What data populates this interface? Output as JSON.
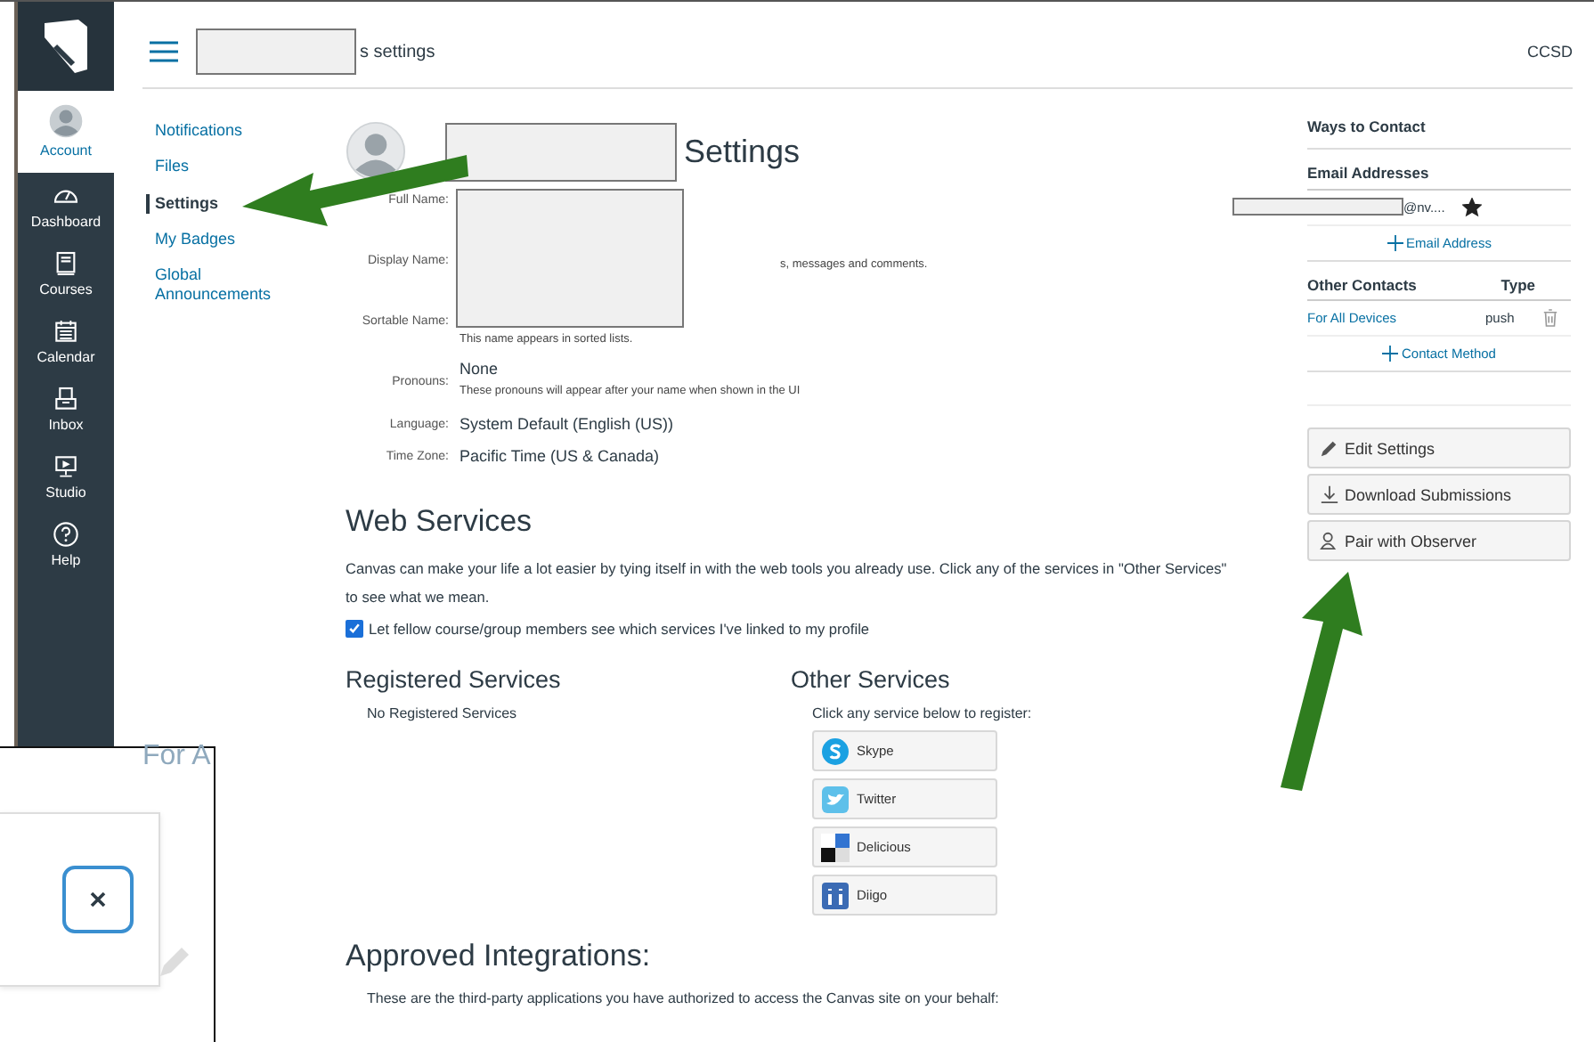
{
  "global_nav": {
    "items": [
      {
        "kind": "account",
        "label": "Account",
        "selected": true
      },
      {
        "kind": "dashboard",
        "label": "Dashboard",
        "selected": false
      },
      {
        "kind": "courses",
        "label": "Courses",
        "selected": false
      },
      {
        "kind": "calendar",
        "label": "Calendar",
        "selected": false
      },
      {
        "kind": "inbox",
        "label": "Inbox",
        "selected": false
      },
      {
        "kind": "studio",
        "label": "Studio",
        "selected": false
      },
      {
        "kind": "help",
        "label": "Help",
        "selected": false
      }
    ]
  },
  "header": {
    "title": "s settings",
    "org": "CCSD"
  },
  "sub_nav": [
    {
      "label": "Notifications",
      "selected": false
    },
    {
      "label": "Files",
      "selected": false
    },
    {
      "label": "Settings",
      "selected": true
    },
    {
      "label": "My Badges",
      "selected": false
    },
    {
      "label": "Global Announcements",
      "selected": false
    }
  ],
  "profile": {
    "title": "Settings",
    "fields": [
      {
        "label": "Full Name:"
      },
      {
        "label": "Display Name:",
        "hint": "s, messages and comments."
      },
      {
        "label": "Sortable Name:",
        "hint": "This name appears in sorted lists."
      },
      {
        "label": "Pronouns:",
        "value": "None",
        "hint": "These pronouns will appear after your name when shown in the UI"
      },
      {
        "label": "Language:",
        "value": "System Default (English (US))"
      },
      {
        "label": "Time Zone:",
        "value": "Pacific Time (US & Canada)"
      }
    ]
  },
  "web_services": {
    "heading": "Web Services",
    "description": "Canvas can make your life a lot easier by tying itself in with the web tools you already use. Click any of the services in \"Other Services\" to see what we mean.",
    "share_checkbox": {
      "label": "Let fellow course/group members see which services I've linked to my profile",
      "checked": true
    },
    "registered": {
      "heading": "Registered Services",
      "empty_text": "No Registered Services"
    },
    "other": {
      "heading": "Other Services",
      "prompt": "Click any service below to register:",
      "services": [
        {
          "kind": "skype",
          "label": "Skype"
        },
        {
          "kind": "twitter",
          "label": "Twitter"
        },
        {
          "kind": "delicious",
          "label": "Delicious"
        },
        {
          "kind": "diigo",
          "label": "Diigo"
        }
      ]
    }
  },
  "approved_integrations": {
    "heading": "Approved Integrations:",
    "description": "These are the third-party applications you have authorized to access the Canvas site on your behalf:"
  },
  "ways_to_contact": {
    "heading": "Ways to Contact",
    "email_heading": "Email Addresses",
    "emails": [
      {
        "address": "@nv....",
        "default": true
      }
    ],
    "add_email": "Email Address",
    "other_contacts": {
      "columns": [
        "Other Contacts",
        "Type"
      ],
      "rows": [
        {
          "name": "For All Devices",
          "type": "push"
        }
      ]
    },
    "add_contact": "Contact Method"
  },
  "actions": [
    {
      "kind": "edit",
      "label": "Edit Settings"
    },
    {
      "kind": "download",
      "label": "Download Submissions"
    },
    {
      "kind": "observer",
      "label": "Pair with Observer"
    }
  ],
  "inset": {
    "faded_text": "For A"
  }
}
